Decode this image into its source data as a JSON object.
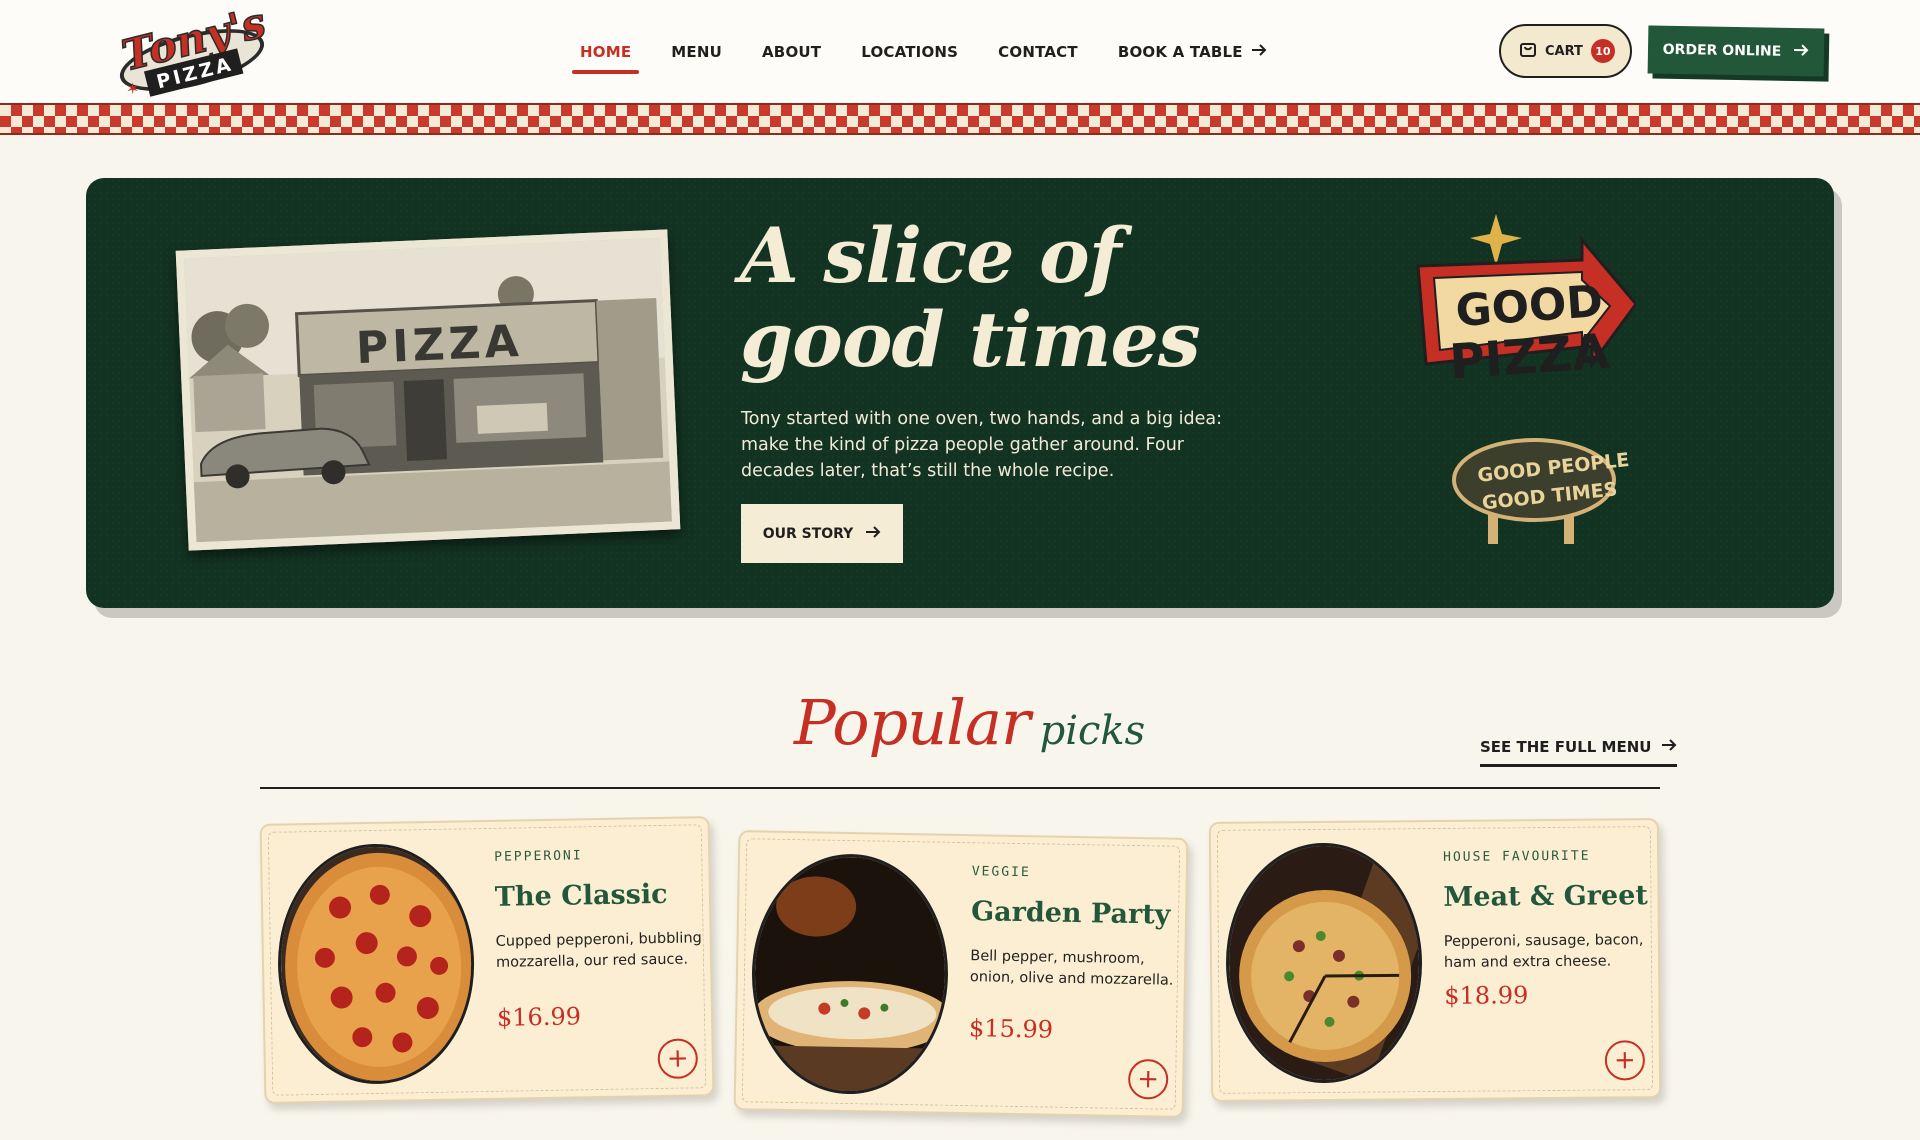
{
  "brand": {
    "logo_script": "Tony's",
    "logo_word": "PIZZA"
  },
  "nav": {
    "items": [
      {
        "label": "HOME"
      },
      {
        "label": "MENU"
      },
      {
        "label": "ABOUT"
      },
      {
        "label": "LOCATIONS"
      },
      {
        "label": "CONTACT"
      },
      {
        "label": "BOOK A TABLE"
      }
    ],
    "active": "HOME"
  },
  "cart": {
    "label": "CART",
    "count": "10"
  },
  "order_button": {
    "label": "ORDER ONLINE"
  },
  "hero": {
    "photo_sign": "PIZZA",
    "title_line1": "A slice of",
    "title_line2": "good times",
    "text": "Tony started with one oven, two hands, and a big idea: make the kind of pizza people gather around. Four decades later, that’s still the whole recipe.",
    "button_label": "OUR STORY",
    "sign": {
      "line1": "GOOD",
      "line2": "PIZZA",
      "line3": "GOOD PEOPLE",
      "line4": "GOOD TIMES"
    }
  },
  "popular": {
    "title_word1": "Popular",
    "title_word2": "picks",
    "see_menu_label": "SEE THE FULL MENU",
    "cards": [
      {
        "category": "PEPPERONI",
        "name": "The Classic",
        "description": "Cupped pepperoni, bubbling mozzarella, our red sauce.",
        "price": "$16.99"
      },
      {
        "category": "VEGGIE",
        "name": "Garden Party",
        "description": "Bell pepper, mushroom, onion, olive and mozzarella.",
        "price": "$15.99"
      },
      {
        "category": "HOUSE FAVOURITE",
        "name": "Meat & Greet",
        "description": "Pepperoni, sausage, bacon, ham and extra cheese.",
        "price": "$18.99"
      }
    ]
  },
  "colors": {
    "brand_red": "#c62f24",
    "brand_green": "#22573a",
    "hero_bg": "#133322",
    "cream": "#f5ecd6"
  }
}
